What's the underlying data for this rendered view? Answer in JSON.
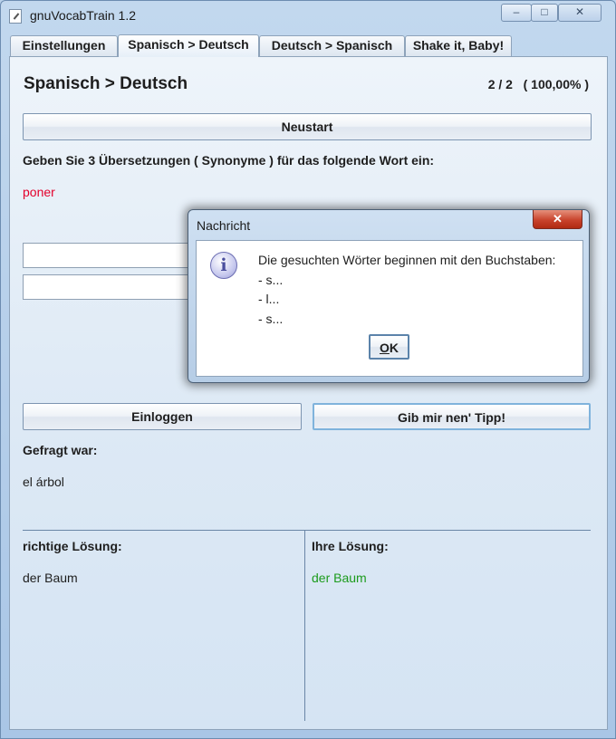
{
  "window": {
    "title": "gnuVocabTrain 1.2",
    "controls": [
      "–",
      "□",
      "✕"
    ]
  },
  "tabs": [
    {
      "label": "Einstellungen"
    },
    {
      "label": "Spanisch > Deutsch",
      "active": true
    },
    {
      "label": "Deutsch > Spanisch"
    },
    {
      "label": "Shake it, Baby!"
    }
  ],
  "main": {
    "title": "Spanisch > Deutsch",
    "score": "2 / 2   ( 100,00% )",
    "restart_label": "Neustart",
    "prompt": "Geben Sie 3 Übersetzungen ( Synonyme ) für das folgende Wort ein:",
    "word": "poner",
    "inputs": [
      {
        "value": ""
      },
      {
        "value": ""
      }
    ],
    "login_label": "Einloggen",
    "tip_label": "Gib mir nen' Tipp!",
    "asked_label": "Gefragt war:",
    "asked_word": "el árbol",
    "correct_label": "richtige Lösung:",
    "correct_value": "der Baum",
    "your_label": "Ihre Lösung:",
    "your_value": "der Baum"
  },
  "dialog": {
    "title": "Nachricht",
    "close_glyph": "✕",
    "icon": "info-icon",
    "icon_glyph": "i",
    "lines": [
      "Die gesuchten Wörter beginnen mit den Buchstaben:",
      "- s...",
      "- l...",
      "- s..."
    ],
    "ok_label": "OK"
  },
  "colors": {
    "word": "#e4002b",
    "your_solution": "#1c9b1c"
  }
}
